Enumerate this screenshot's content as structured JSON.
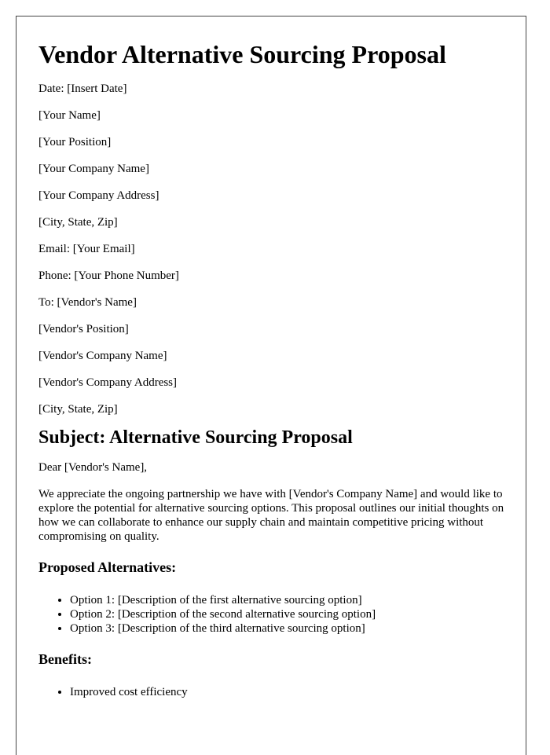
{
  "title": "Vendor Alternative Sourcing Proposal",
  "header_lines": [
    "Date: [Insert Date]",
    "[Your Name]",
    "[Your Position]",
    "[Your Company Name]",
    "[Your Company Address]",
    "[City, State, Zip]",
    "Email: [Your Email]",
    "Phone: [Your Phone Number]",
    "To: [Vendor's Name]",
    "[Vendor's Position]",
    "[Vendor's Company Name]",
    "[Vendor's Company Address]",
    "[City, State, Zip]"
  ],
  "subject": "Subject: Alternative Sourcing Proposal",
  "salutation": "Dear [Vendor's Name],",
  "intro": "We appreciate the ongoing partnership we have with [Vendor's Company Name] and would like to explore the potential for alternative sourcing options. This proposal outlines our initial thoughts on how we can collaborate to enhance our supply chain and maintain competitive pricing without compromising on quality.",
  "alternatives": {
    "heading": "Proposed Alternatives:",
    "items": [
      "Option 1: [Description of the first alternative sourcing option]",
      "Option 2: [Description of the second alternative sourcing option]",
      "Option 3: [Description of the third alternative sourcing option]"
    ]
  },
  "benefits": {
    "heading": "Benefits:",
    "items": [
      "Improved cost efficiency"
    ]
  }
}
